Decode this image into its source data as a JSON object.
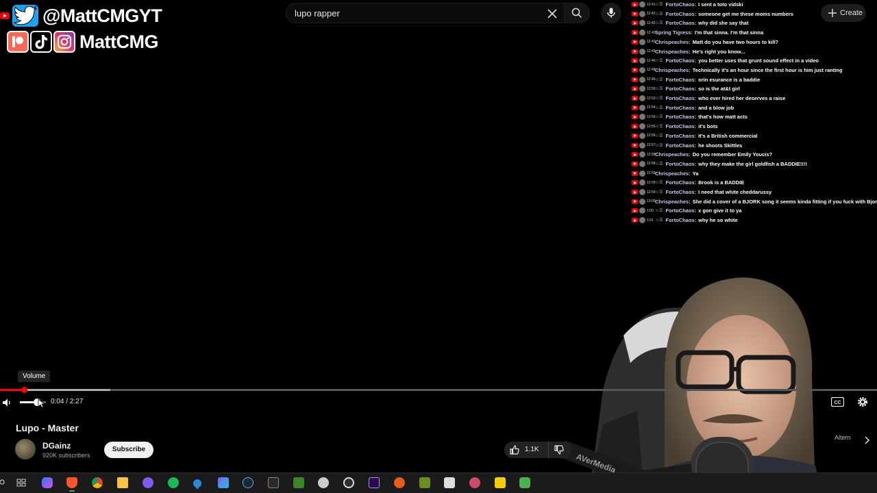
{
  "search": {
    "query": "lupo rapper"
  },
  "header": {
    "create_label": "Create"
  },
  "social": {
    "handle_twitter": "@MattCMGYT",
    "handle_other": "MattCMG",
    "twitter_color": "#1DA1F2",
    "patreon_color": "#F96854",
    "tiktok_color": "#000000",
    "instagram_color": "#C13584"
  },
  "chat": {
    "messages": [
      {
        "time": "12:41",
        "user": "FortoChaos:",
        "text": "I sent a toto vidski"
      },
      {
        "time": "12:42",
        "user": "FortoChaos:",
        "text": "someone get me these moms numbers"
      },
      {
        "time": "12:42",
        "user": "FortoChaos:",
        "text": "why did she say that"
      },
      {
        "time": "12:43",
        "user": "Spring Tigress:",
        "text": "I'm that sinna. I'm that sinna"
      },
      {
        "time": "12:43",
        "user": "Chrispeaches:",
        "text": "Matt do you have two hours to kill?"
      },
      {
        "time": "12:45",
        "user": "Chrispeaches:",
        "text": "He's right you know..."
      },
      {
        "time": "12:46",
        "user": "FortoChaos:",
        "text": "you better uses that grunt sound effect in a video"
      },
      {
        "time": "12:48",
        "user": "Chrispeaches:",
        "text": "Technically it's an hour since the first hour is him just ranting"
      },
      {
        "time": "12:49",
        "user": "FortoChaos:",
        "text": "orin esurance is a baddie"
      },
      {
        "time": "12:50",
        "user": "FortoChaos:",
        "text": "so is the at&t girl"
      },
      {
        "time": "12:52",
        "user": "FortoChaos:",
        "text": "who ever hired her deserves a raise"
      },
      {
        "time": "12:54",
        "user": "FortoChaos:",
        "text": "and a blow job"
      },
      {
        "time": "12:55",
        "user": "FortoChaos:",
        "text": "that's how matt acts"
      },
      {
        "time": "12:55",
        "user": "FortoChaos:",
        "text": "it's bots"
      },
      {
        "time": "12:56",
        "user": "FortoChaos:",
        "text": "It's a British commercial"
      },
      {
        "time": "12:57",
        "user": "FortoChaos:",
        "text": "he shoots Skittles"
      },
      {
        "time": "12:58",
        "user": "Chrispeaches:",
        "text": "Do you remember Emily Youcis?"
      },
      {
        "time": "12:58",
        "user": "FortoChaos:",
        "text": "why they make the girl goldfish a BADDIE!!!!"
      },
      {
        "time": "12:59",
        "user": "Chrispeaches:",
        "text": "Ya"
      },
      {
        "time": "12:59",
        "user": "FortoChaos:",
        "text": "Brook is a BADDIE"
      },
      {
        "time": "12:59",
        "user": "FortoChaos:",
        "text": "I need that white cheddarussy"
      },
      {
        "time": "13:00",
        "user": "Chrispeaches:",
        "text": "She did a cover of a BJORK song it seems kinda fitting if you fuck with Bjork"
      },
      {
        "time": "1:00",
        "user": "FortoChaos:",
        "text": "x gon give it to ya"
      },
      {
        "time": "1:01",
        "user": "FortoChaos:",
        "text": "why he so white"
      }
    ]
  },
  "player": {
    "tooltip": "Volume",
    "time": "0:04 / 2:27",
    "progress": 0.027,
    "buffered": 0.126,
    "volume": 0.65,
    "played_color": "#FF0000"
  },
  "video": {
    "title": "Lupo - Master",
    "channel": "DGainz",
    "subscribers": "920K subscribers",
    "subscribe_label": "Subscribe",
    "likes": "1.1K",
    "alt_label": "Altern"
  }
}
